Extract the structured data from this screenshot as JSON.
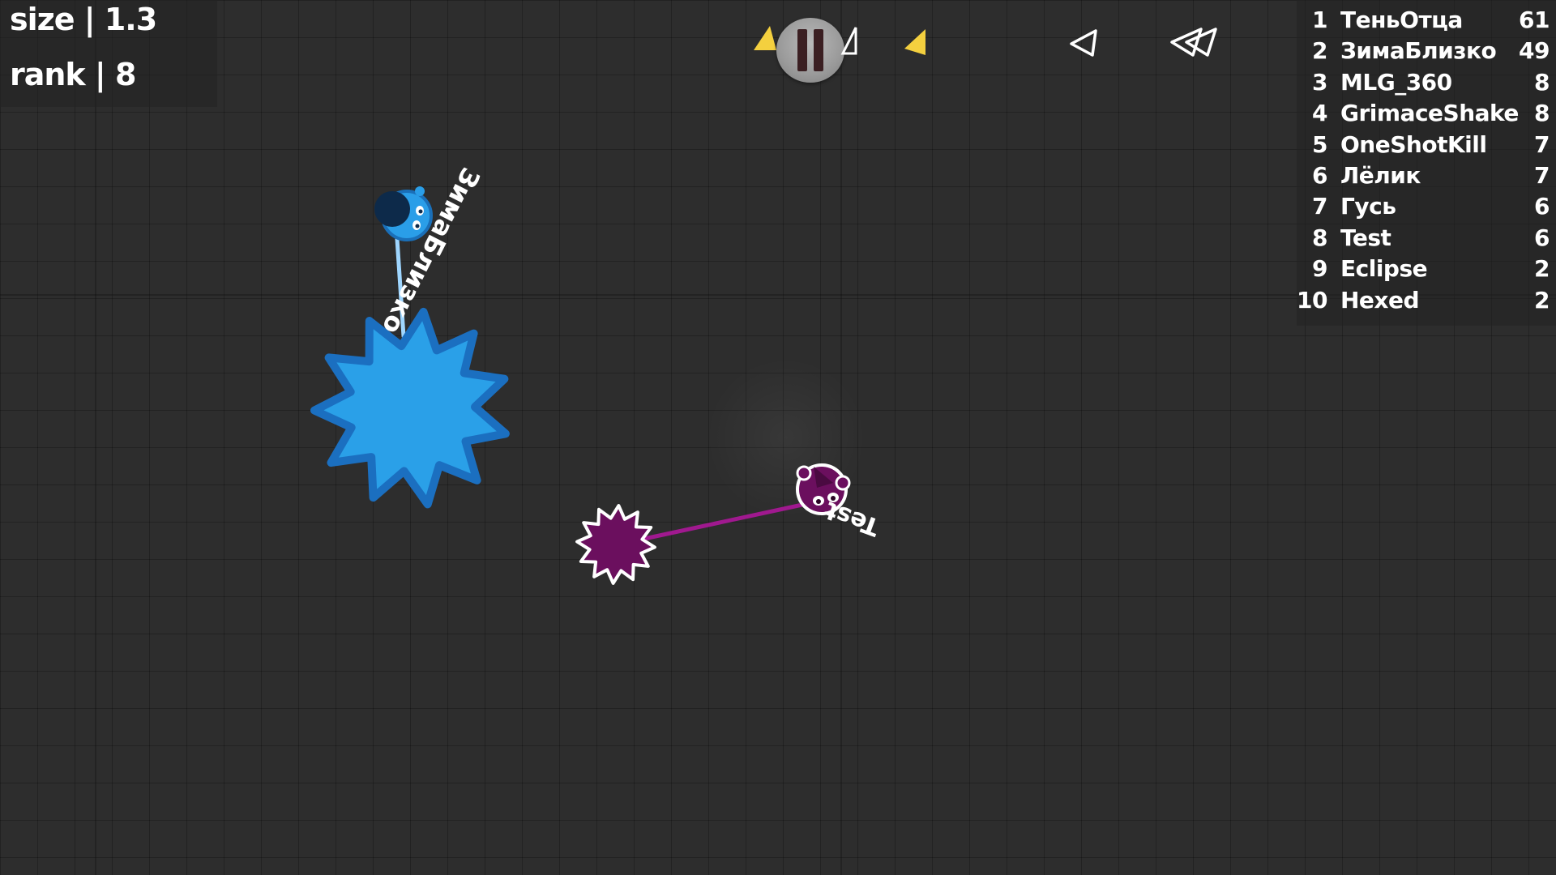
{
  "stats": {
    "size_text": "size | 1.3",
    "rank_text": "rank | 8"
  },
  "hud": {
    "pause_icon": "pause-icon",
    "indicators": [
      {
        "icon": "triangle-yellow-icon",
        "color": "#f4d03f"
      },
      {
        "icon": "triangle-white-outline-icon",
        "color": "#ffffff"
      },
      {
        "icon": "triangle-yellow-icon",
        "color": "#f4d03f"
      },
      {
        "icon": "triangle-white-outline-icon",
        "color": "#ffffff"
      },
      {
        "icon": "double-chevron-icon",
        "color": "#ffffff"
      }
    ]
  },
  "leaderboard": [
    {
      "rank": "1",
      "name": "ТеньОтца",
      "score": "61"
    },
    {
      "rank": "2",
      "name": "ЗимаБлизко",
      "score": "49"
    },
    {
      "rank": "3",
      "name": "MLG_360",
      "score": "8"
    },
    {
      "rank": "4",
      "name": "GrimaceShake",
      "score": "8"
    },
    {
      "rank": "5",
      "name": "OneShotKill",
      "score": "7"
    },
    {
      "rank": "6",
      "name": "Лёлик",
      "score": "7"
    },
    {
      "rank": "7",
      "name": "Гусь",
      "score": "6"
    },
    {
      "rank": "8",
      "name": "Test",
      "score": "6"
    },
    {
      "rank": "9",
      "name": "Eclipse",
      "score": "2"
    },
    {
      "rank": "10",
      "name": "Hexed",
      "score": "2"
    }
  ],
  "players": {
    "blue": {
      "name": "ЗимаБлизко",
      "color": "#2a9ee8",
      "dark": "#1a6fb8"
    },
    "purple": {
      "name": "Test",
      "color": "#6b0f5e",
      "rope": "#a0198f"
    }
  }
}
